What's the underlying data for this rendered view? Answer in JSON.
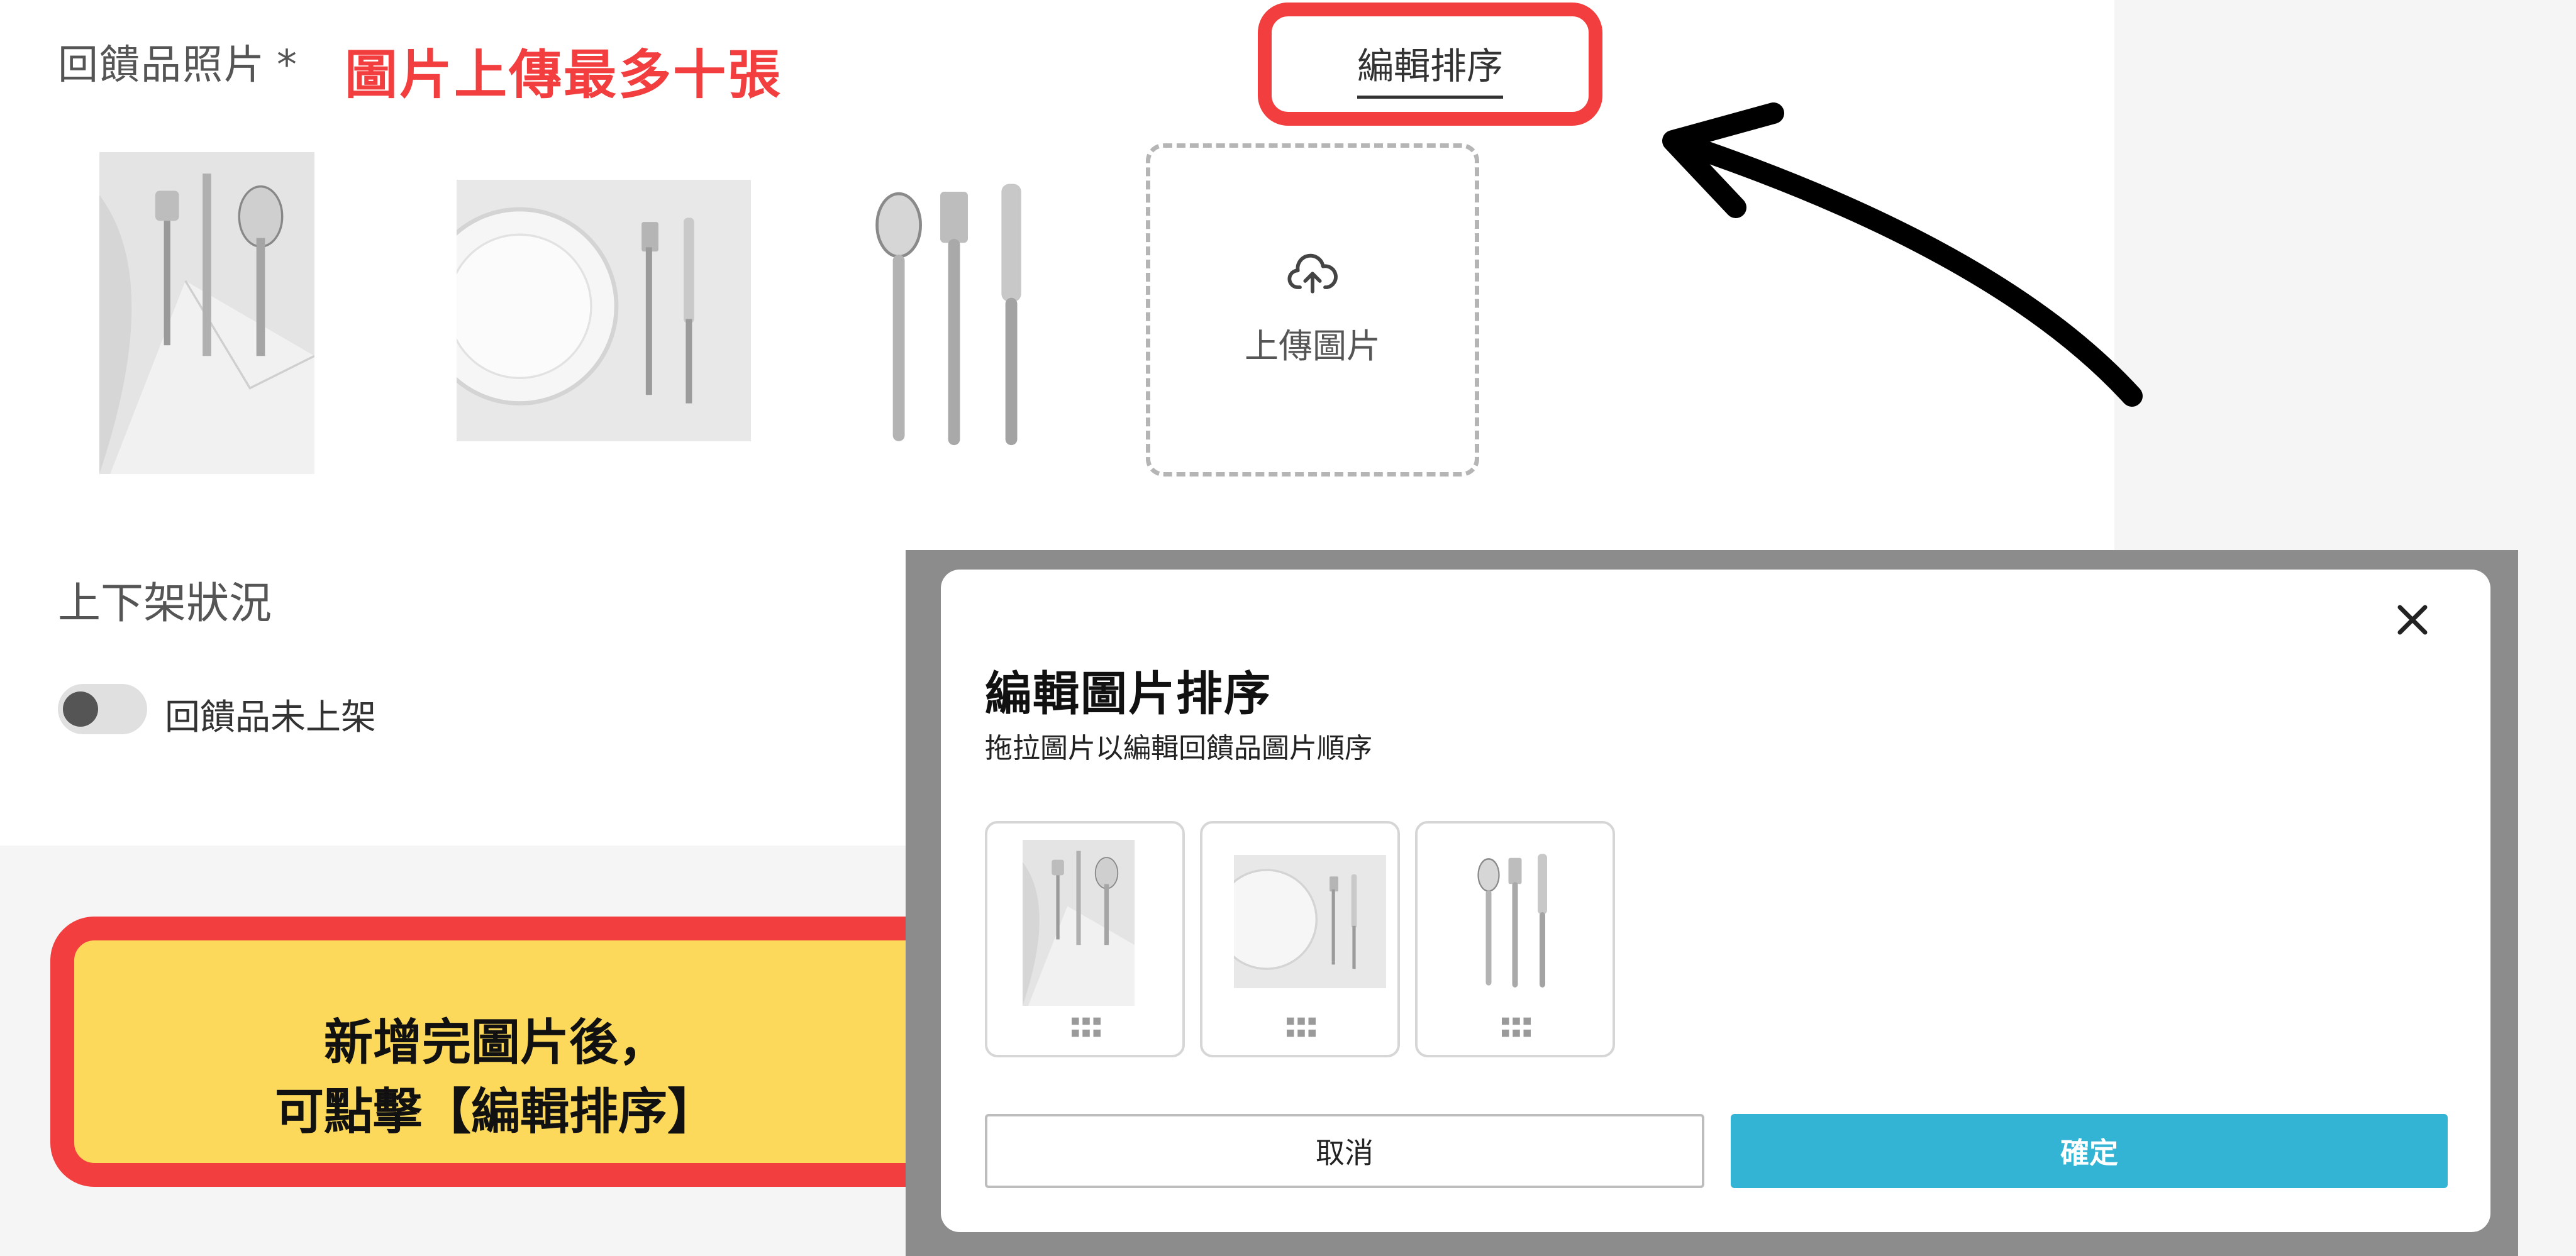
{
  "form": {
    "photos_label": "回饋品照片",
    "photos_required_mark": "*",
    "limit_note": "圖片上傳最多十張",
    "edit_sort_link": "編輯排序",
    "upload_label": "上傳圖片",
    "upload_icon": "cloud-upload-icon",
    "status_title": "上下架狀況",
    "toggle_label": "回饋品未上架",
    "toggle_on": false
  },
  "callout": {
    "line1": "新增完圖片後，",
    "line2": "可點擊【編輯排序】"
  },
  "modal": {
    "title": "編輯圖片排序",
    "subtitle": "拖拉圖片以編輯回饋品圖片順序",
    "close_icon": "close-icon",
    "drag_icon": "drag-handle-icon",
    "cancel_label": "取消",
    "confirm_label": "確定"
  },
  "colors": {
    "highlight": "#f23e3e",
    "callout_bg": "#fcd95a",
    "confirm": "#33b4d4"
  }
}
